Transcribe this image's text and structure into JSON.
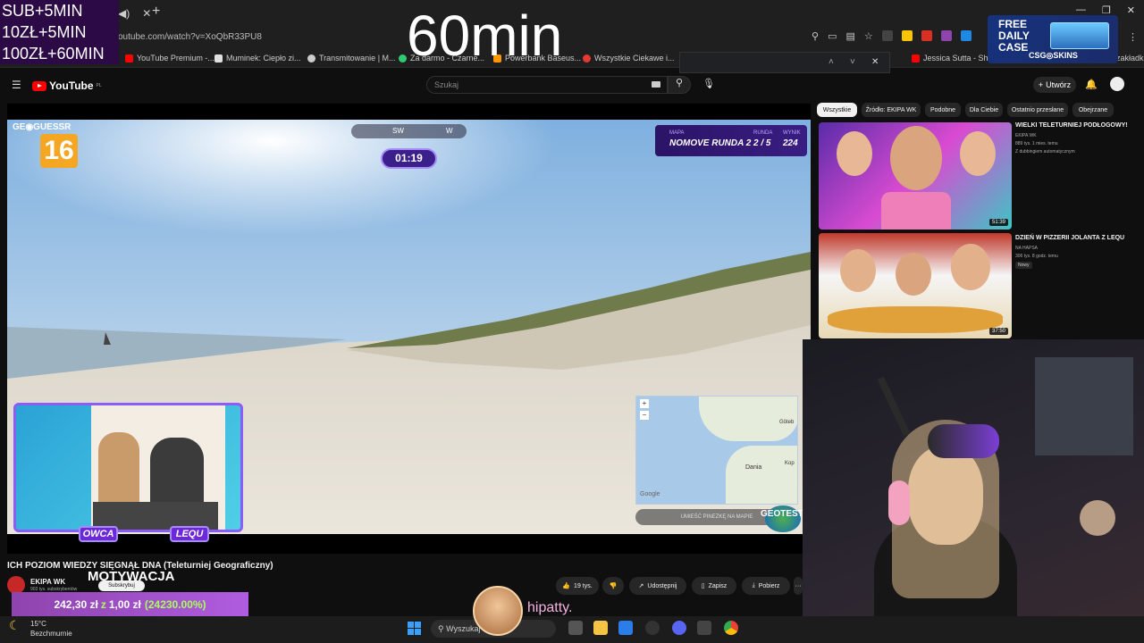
{
  "stream_overlay": {
    "sub_lines": [
      "SUB+5MIN",
      "10ZŁ+5MIN",
      "100ZŁ+60MIN"
    ],
    "timer": "60min",
    "ad": {
      "line1": "FREE",
      "line2": "DAILY",
      "line3": "CASE",
      "brand": "CSG◎SKINS"
    },
    "chat_user": "hipatty."
  },
  "browser": {
    "url": "outube.com/watch?v=XoQbR33PU8",
    "bookmarks": [
      {
        "label": "YouTube Premium -...",
        "color": "#ff0000"
      },
      {
        "label": "Muminek: Ciepło zi...",
        "color": "#e0e0e0"
      },
      {
        "label": "Transmitowanie | M...",
        "color": "#cccccc"
      },
      {
        "label": "Za darmo - Czarne...",
        "color": "#2ecc71"
      },
      {
        "label": "Powerbank Baseus...",
        "color": "#ff9800"
      },
      {
        "label": "Wszystkie Ciekawe i...",
        "color": "#e53935"
      },
      {
        "label": "Jessica Sutta - Show",
        "color": "#ff0000"
      },
      {
        "label": "zakładki",
        "color": "#f9a825"
      }
    ]
  },
  "youtube": {
    "brand": "YouTube",
    "region": "PL",
    "search_placeholder": "Szukaj",
    "create_label": "Utwórz",
    "video": {
      "title": "ICH POZIOM WIEDZY SIĘGNĄŁ DNA (Teleturniej Geograficzny)",
      "channel": "EKIPA WK",
      "subs": "903 tys. subskrybentów",
      "subscribe_tooltip": "Subskrybuj",
      "likes": "19 tys.",
      "share": "Udostępnij",
      "save": "Zapisz",
      "download": "Pobierz",
      "more": "···"
    },
    "game_hud": {
      "logo": "GE◉GUESSR",
      "round_badge": "16",
      "compass_sw": "SW",
      "compass_w": "W",
      "time": "01:19",
      "mapa_label": "MAPA",
      "runda_label": "RUNDA",
      "wynik_label": "WYNIK",
      "map_name": "NOMOVE RUNDA 2",
      "round": "2 / 5",
      "score": "224",
      "map_country": "Dania",
      "map_city1": "Göteb",
      "map_city2": "Kop",
      "map_cta": "UMIEŚĆ PINEZKĘ NA MAPIE",
      "google": "Google",
      "geotest": "GEOTEST",
      "host_left": "OWCA",
      "host_right": "LEQU"
    },
    "filters": [
      "Wszystkie",
      "Źródło: EKIPA WK",
      "Podobne",
      "Dla Ciebie",
      "Ostatnio przesłane",
      "Obejrzane"
    ],
    "recommended": [
      {
        "title": "WIELKI TELETURNIEJ PODŁOGOWY!",
        "channel": "EKIPA WK",
        "meta": "889 tys. 1 mies. temu",
        "extra": "Z dubbingiem automatycznym",
        "duration": "51:39"
      },
      {
        "title": "DZIEŃ W PIZZERII JOLANTA Z LEQU",
        "channel": "NA HAPSA",
        "meta": "306 tys. 8 godz. temu",
        "extra": "Nowy",
        "duration": "37:50"
      }
    ]
  },
  "overlay": {
    "motywacja": "MOTYWACJA",
    "donation_amount": "242,30 zł",
    "donation_z": "z",
    "donation_goal": "1,00 zł",
    "donation_pct": "(24230.00%)"
  },
  "taskbar": {
    "temperature": "15°C",
    "weather": "Bezchmurnie",
    "search": "Wyszukaj"
  }
}
